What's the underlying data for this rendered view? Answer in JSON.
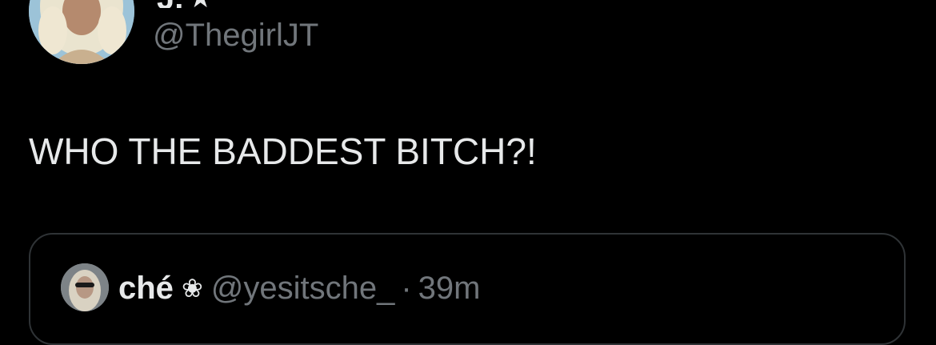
{
  "tweet": {
    "author_name": "J.",
    "verified_glyph": "★",
    "author_handle": "@ThegirlJT",
    "text": "WHO THE BADDEST BITCH?!"
  },
  "quoted_tweet": {
    "author_name": "ché",
    "name_glyph": "❀",
    "author_handle": "@yesitsche_",
    "separator": "·",
    "time": "39m"
  },
  "icons": {
    "avatar": "profile-photo",
    "verified": "star-icon",
    "quote_avatar": "profile-photo",
    "flower": "flower-icon"
  },
  "colors": {
    "background": "#000000",
    "primary_text": "#e7e9ea",
    "secondary_text": "#71767b",
    "border": "#2f3336"
  }
}
